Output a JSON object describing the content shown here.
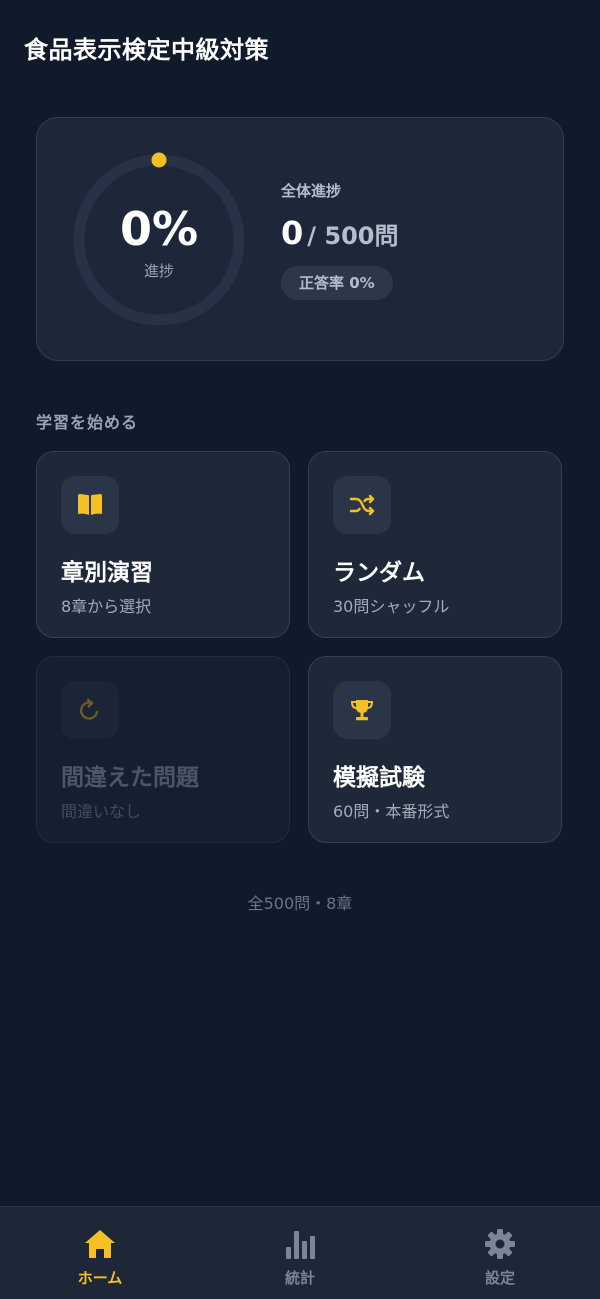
{
  "app": {
    "title": "食品表示検定中級対策"
  },
  "colors": {
    "accent": "#f5c024",
    "background": "#111a2b",
    "card": "#1e2739",
    "muted_icon": "#7b8598"
  },
  "progress": {
    "percent_text": "0%",
    "percent_value": 0,
    "ring_label": "進捗",
    "overall_label": "全体進捗",
    "done": "0",
    "total": "/ 500問",
    "accuracy": "正答率 0%"
  },
  "section": {
    "heading": "学習を始める"
  },
  "menu": {
    "chapter": {
      "title": "章別演習",
      "subtitle": "8章から選択",
      "icon": "book-icon"
    },
    "random": {
      "title": "ランダム",
      "subtitle": "30問シャッフル",
      "icon": "shuffle-icon"
    },
    "mistakes": {
      "title": "間違えた問題",
      "subtitle": "間違いなし",
      "icon": "retry-icon"
    },
    "mock": {
      "title": "模擬試験",
      "subtitle": "60問・本番形式",
      "icon": "trophy-icon"
    }
  },
  "footer": {
    "summary": "全500問・8章"
  },
  "tabs": {
    "home": {
      "label": "ホーム",
      "icon": "home-icon",
      "active": true
    },
    "stats": {
      "label": "統計",
      "icon": "bar-chart-icon",
      "active": false
    },
    "settings": {
      "label": "設定",
      "icon": "gear-icon",
      "active": false
    }
  }
}
